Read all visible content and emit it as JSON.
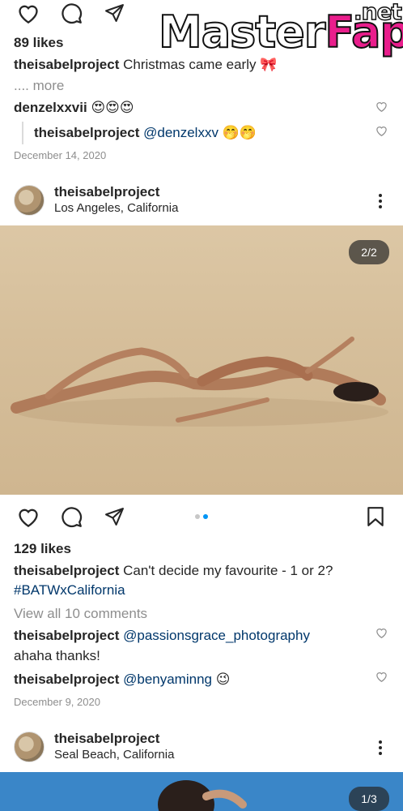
{
  "watermark": {
    "part1": "Master",
    "part2": "Fap",
    "part3": ".net"
  },
  "post1": {
    "likes": "89 likes",
    "author": "theisabelproject",
    "caption": "Christmas came early 🎀",
    "more": ".... more",
    "comment1": {
      "user": "denzelxxvii",
      "text": "😍😍😍"
    },
    "reply1": {
      "user": "theisabelproject",
      "mention": "@denzelxxv",
      "emoji": "🤭🤭"
    },
    "date": "December 14, 2020"
  },
  "post2": {
    "username": "theisabelproject",
    "location": "Los Angeles, California",
    "counter": "2/2",
    "likes": "129 likes",
    "caption_user": "theisabelproject",
    "caption": "Can't decide my favourite - 1 or 2?",
    "hashtag": "#BATWxCalifornia",
    "view_comments": "View all 10 comments",
    "comment1": {
      "user": "theisabelproject",
      "mention": "@passionsgrace_photography",
      "text": "ahaha thanks!"
    },
    "comment2": {
      "user": "theisabelproject",
      "mention": "@benyaminng",
      "emoji": "😉"
    },
    "date": "December 9, 2020"
  },
  "post3": {
    "username": "theisabelproject",
    "location": "Seal Beach, California",
    "counter": "1/3"
  },
  "icons": [
    "heart-icon",
    "comment-icon",
    "share-icon",
    "bookmark-icon",
    "more-icon"
  ],
  "colors": {
    "link": "#00376b",
    "muted": "#8e8e8e",
    "dot_active": "#0095f6",
    "sand": "#d9c3a0",
    "sky": "#3a86c8"
  }
}
